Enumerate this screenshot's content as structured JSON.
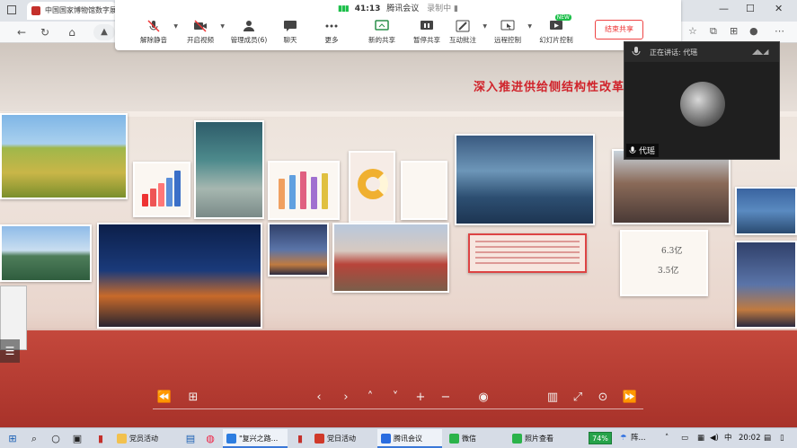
{
  "browser": {
    "tab_title": "中国国家博物馆数字展厅",
    "lock_label": "▲"
  },
  "meeting": {
    "signal": "▮▮▮",
    "time": "41:13",
    "app_name": "腾讯会议",
    "recording": "录制中 ▮",
    "tools": [
      {
        "label": "解除静音",
        "icon": "mic-muted-icon"
      },
      {
        "label": "开启视频",
        "icon": "video-off-icon"
      },
      {
        "label": "管理成员(6)",
        "icon": "members-icon"
      },
      {
        "label": "聊天",
        "icon": "chat-icon"
      },
      {
        "label": "更多",
        "icon": "more-icon"
      },
      {
        "label": "新的共享",
        "icon": "share-icon"
      },
      {
        "label": "暂停共享",
        "icon": "pause-share-icon"
      },
      {
        "label": "互动批注",
        "icon": "annotate-icon"
      },
      {
        "label": "远程控制",
        "icon": "remote-control-icon"
      },
      {
        "label": "幻灯片控制",
        "icon": "slides-icon"
      }
    ],
    "new_badge": "NEW",
    "end_share": "结束共享"
  },
  "scene": {
    "headline": "深入推进供给侧结构性改革",
    "stat_1": "6.3亿",
    "stat_2": "3.5亿"
  },
  "speaker": {
    "speaking_label": "正在讲话: 代瑶",
    "name": "代瑶"
  },
  "viewer_controls": [
    "rewind-icon",
    "grid-icon",
    "prev-icon",
    "next-icon",
    "up-icon",
    "down-icon",
    "zoom-in-icon",
    "zoom-out-icon",
    "eye-icon",
    "map-icon",
    "fullscreen-icon",
    "download-icon",
    "forward-icon"
  ],
  "taskbar": {
    "items": [
      {
        "label": "党员活动"
      },
      {
        "label": "\"复兴之路..."
      },
      {
        "label": "党日活动"
      },
      {
        "label": "腾讯会议"
      },
      {
        "label": "微信"
      },
      {
        "label": "照片查看"
      }
    ],
    "battery": "74%",
    "weather": "阵...",
    "ime": "中",
    "clock": "20:02"
  },
  "colors": {
    "accent_red": "#d0222a",
    "meeting_green": "#1dbf4a",
    "taskbar_bg": "#d6dce6"
  }
}
